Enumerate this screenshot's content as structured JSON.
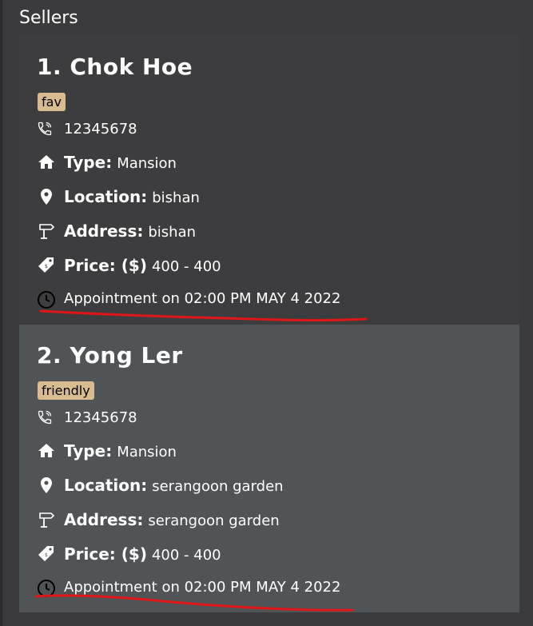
{
  "panel": {
    "title": "Sellers"
  },
  "sellers": [
    {
      "index_name": "1.  Chok Hoe",
      "tag": "fav",
      "phone": "12345678",
      "type_label": "Type:",
      "type_value": "Mansion",
      "location_label": "Location:",
      "location_value": "bishan",
      "address_label": "Address:",
      "address_value": "bishan",
      "price_label": "Price: ($)",
      "price_value": "400 - 400",
      "appointment": "Appointment on 02:00 PM MAY 4 2022"
    },
    {
      "index_name": "2.  Yong Ler",
      "tag": "friendly",
      "phone": "12345678",
      "type_label": "Type:",
      "type_value": "Mansion",
      "location_label": "Location:",
      "location_value": "serangoon garden",
      "address_label": "Address:",
      "address_value": "serangoon garden",
      "price_label": "Price: ($)",
      "price_value": "400 - 400",
      "appointment": "Appointment on 02:00 PM MAY 4 2022"
    }
  ],
  "colors": {
    "background": "#3b3b3d",
    "card_default": "#3d3d40",
    "card_selected": "#505457",
    "tag": "#d8bc90",
    "annotation": "#e01515"
  },
  "icons": [
    "phone-icon",
    "home-icon",
    "location-pin-icon",
    "signpost-icon",
    "price-tag-icon",
    "clock-icon"
  ]
}
